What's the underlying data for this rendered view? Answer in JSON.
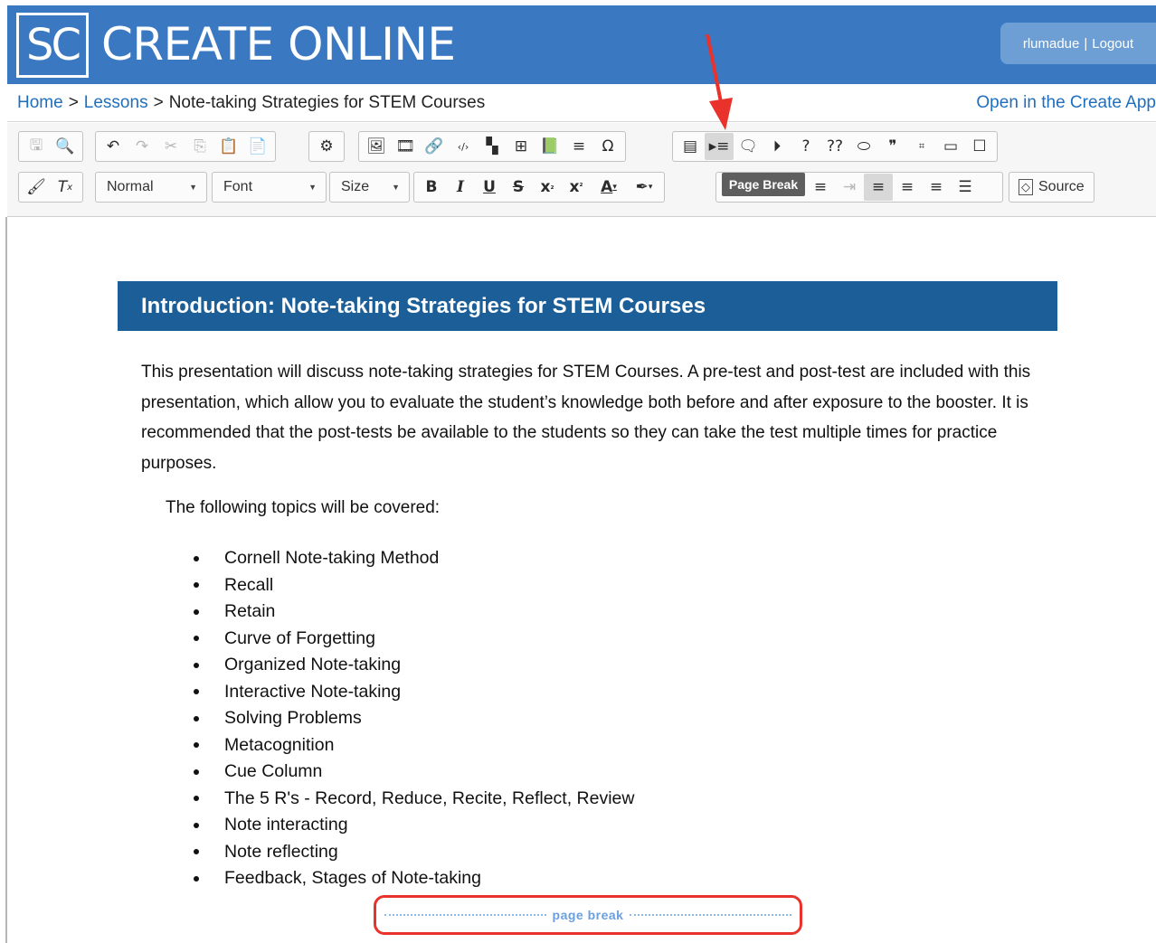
{
  "header": {
    "logo": "SC",
    "brand": "CREATE ONLINE",
    "user": "rlumadue",
    "separator": "|",
    "logout": "Logout"
  },
  "breadcrumb": {
    "home": "Home",
    "sep": ">",
    "lessons": "Lessons",
    "current": "Note-taking Strategies for STEM Courses",
    "open_app": "Open in the Create App"
  },
  "toolbar": {
    "row1": {
      "group1": [
        {
          "name": "save-icon",
          "glyph": "🖫"
        },
        {
          "name": "preview-icon",
          "glyph": "🔍"
        }
      ],
      "group2": [
        {
          "name": "undo-icon",
          "glyph": "↶"
        },
        {
          "name": "redo-icon",
          "glyph": "↷"
        },
        {
          "name": "cut-icon",
          "glyph": "✂"
        },
        {
          "name": "copy-icon",
          "glyph": "⎘"
        },
        {
          "name": "paste-icon",
          "glyph": "📋"
        },
        {
          "name": "paste-text-icon",
          "glyph": "📄"
        }
      ],
      "group3": [
        {
          "name": "settings-gear-icon",
          "glyph": "⚙"
        }
      ],
      "group4": [
        {
          "name": "image-icon",
          "glyph": "🖼"
        },
        {
          "name": "media-icon",
          "glyph": "🎞"
        },
        {
          "name": "link-icon",
          "glyph": "🔗"
        },
        {
          "name": "code-icon",
          "glyph": "‹/›"
        },
        {
          "name": "widget-icon",
          "glyph": "▚"
        },
        {
          "name": "table-icon",
          "glyph": "⊞"
        },
        {
          "name": "glossary-book-icon",
          "glyph": "📗"
        },
        {
          "name": "horizontal-line-icon",
          "glyph": "≡"
        },
        {
          "name": "special-char-icon",
          "glyph": "Ω"
        }
      ],
      "group5": [
        {
          "name": "template-icon",
          "glyph": "▤"
        },
        {
          "name": "page-break-icon",
          "glyph": "▸≡"
        },
        {
          "name": "comment-icon",
          "glyph": "🗨"
        },
        {
          "name": "play-icon",
          "glyph": "⏵"
        },
        {
          "name": "question-icon",
          "glyph": "?"
        },
        {
          "name": "double-question-icon",
          "glyph": "??"
        },
        {
          "name": "tag-icon",
          "glyph": "⬭"
        },
        {
          "name": "quote-icon",
          "glyph": "❞"
        },
        {
          "name": "div-icon",
          "glyph": "⌗"
        },
        {
          "name": "show-blocks-icon",
          "glyph": "▭"
        },
        {
          "name": "maximize-icon",
          "glyph": "☐"
        }
      ]
    },
    "row2": {
      "format_label": "Normal",
      "font_label": "Font",
      "size_label": "Size",
      "source_label": "Source"
    },
    "tooltip": "Page Break"
  },
  "content": {
    "heading": "Introduction: Note-taking Strategies for STEM Courses",
    "paragraph": "This presentation will discuss note-taking strategies for STEM Courses.  A pre-test and post-test are included with this presentation, which allow you to evaluate the student’s knowledge both before and after exposure to the booster. It is recommended that the post-tests be available to the students so they can take the test multiple times for practice purposes.",
    "topics_intro": "The following topics will be covered:",
    "topics": [
      "Cornell Note-taking Method",
      "Recall",
      "Retain",
      "Curve of Forgetting",
      "Organized Note-taking",
      "Interactive Note-taking",
      "Solving Problems",
      "Metacognition",
      "Cue Column",
      "The 5 R's - Record, Reduce, Recite, Reflect, Review",
      "Note interacting",
      "Note reflecting",
      "Feedback, Stages of Note-taking"
    ],
    "page_break_label": "page break"
  },
  "colors": {
    "header_blue": "#3b78c2",
    "heading_blue": "#1c5f98",
    "link_blue": "#1f6fbf",
    "annotation_red": "#e8322b"
  }
}
